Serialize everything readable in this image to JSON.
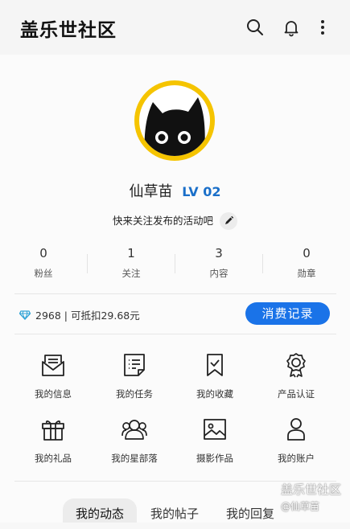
{
  "app": {
    "title": "盖乐世社区"
  },
  "profile": {
    "username": "仙草苗",
    "level": "LV 02",
    "bio": "快来关注发布的活动吧"
  },
  "stats": [
    {
      "value": "0",
      "label": "粉丝"
    },
    {
      "value": "1",
      "label": "关注"
    },
    {
      "value": "3",
      "label": "内容"
    },
    {
      "value": "0",
      "label": "勋章"
    }
  ],
  "points": {
    "text": "2968 | 可抵扣29.68元",
    "button": "消费记录"
  },
  "grid": [
    {
      "label": "我的信息",
      "icon": "message-envelope-icon"
    },
    {
      "label": "我的任务",
      "icon": "task-list-icon"
    },
    {
      "label": "我的收藏",
      "icon": "bookmark-check-icon"
    },
    {
      "label": "产品认证",
      "icon": "certified-badge-icon"
    },
    {
      "label": "我的礼品",
      "icon": "gift-icon"
    },
    {
      "label": "我的星部落",
      "icon": "group-icon"
    },
    {
      "label": "摄影作品",
      "icon": "image-icon"
    },
    {
      "label": "我的账户",
      "icon": "user-icon"
    }
  ],
  "tabs": [
    {
      "label": "我的动态",
      "active": true
    },
    {
      "label": "我的帖子",
      "active": false
    },
    {
      "label": "我的回复",
      "active": false
    }
  ],
  "watermark": {
    "line1": "盖乐世社区",
    "line2": "@仙草苗"
  },
  "colors": {
    "accent": "#1a73e8",
    "level": "#1a6fc9",
    "avatar_ring": "#f5c400"
  }
}
